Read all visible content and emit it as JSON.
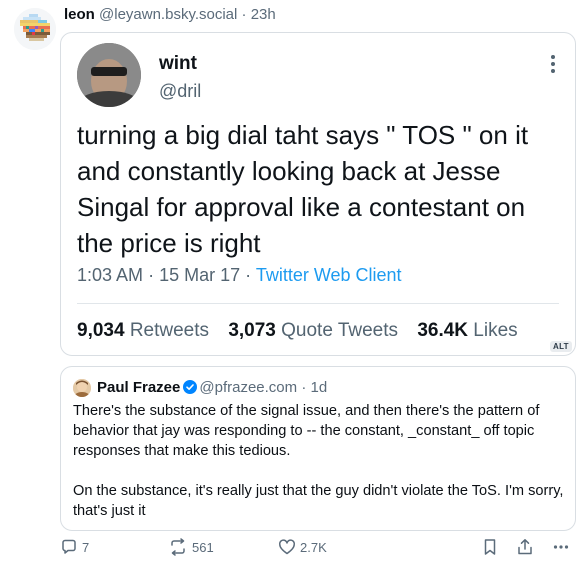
{
  "post": {
    "author_name": "leon",
    "author_handle": "@leyawn.bsky.social",
    "separator": "·",
    "age": "23h"
  },
  "embedded_tweet": {
    "name": "wint",
    "handle": "@dril",
    "text": "turning a big dial taht says \"  TOS   \" on it and constantly looking back at Jesse Singal  for approval like a contestant on the price is right",
    "time": "1:03 AM",
    "date": "15 Mar 17",
    "client": "Twitter Web Client",
    "retweets_count": "9,034",
    "retweets_label": "Retweets",
    "quotes_count": "3,073",
    "quotes_label": "Quote Tweets",
    "likes_count": "36.4K",
    "likes_label": "Likes",
    "alt_badge": "ALT"
  },
  "quote": {
    "name": "Paul Frazee",
    "handle": "@pfrazee.com",
    "separator": "·",
    "age": "1d",
    "paragraph1": "There's the substance of the signal issue, and then there's the pattern of behavior that jay was responding to -- the constant, _constant_ off topic responses that make this tedious.",
    "paragraph2": "On the substance, it's really just that the guy didn't violate the ToS. I'm sorry, that's just it"
  },
  "actions": {
    "replies": "7",
    "reposts": "561",
    "likes": "2.7K"
  },
  "colors": {
    "link": "#1d9bf0",
    "muted": "#5b6b7a",
    "verified": "#0085ff"
  },
  "icons": [
    "pixel-avatar-icon",
    "more-vertical-icon",
    "verified-icon",
    "reply-icon",
    "repost-icon",
    "like-icon",
    "bookmark-icon",
    "share-icon",
    "more-horizontal-icon"
  ]
}
